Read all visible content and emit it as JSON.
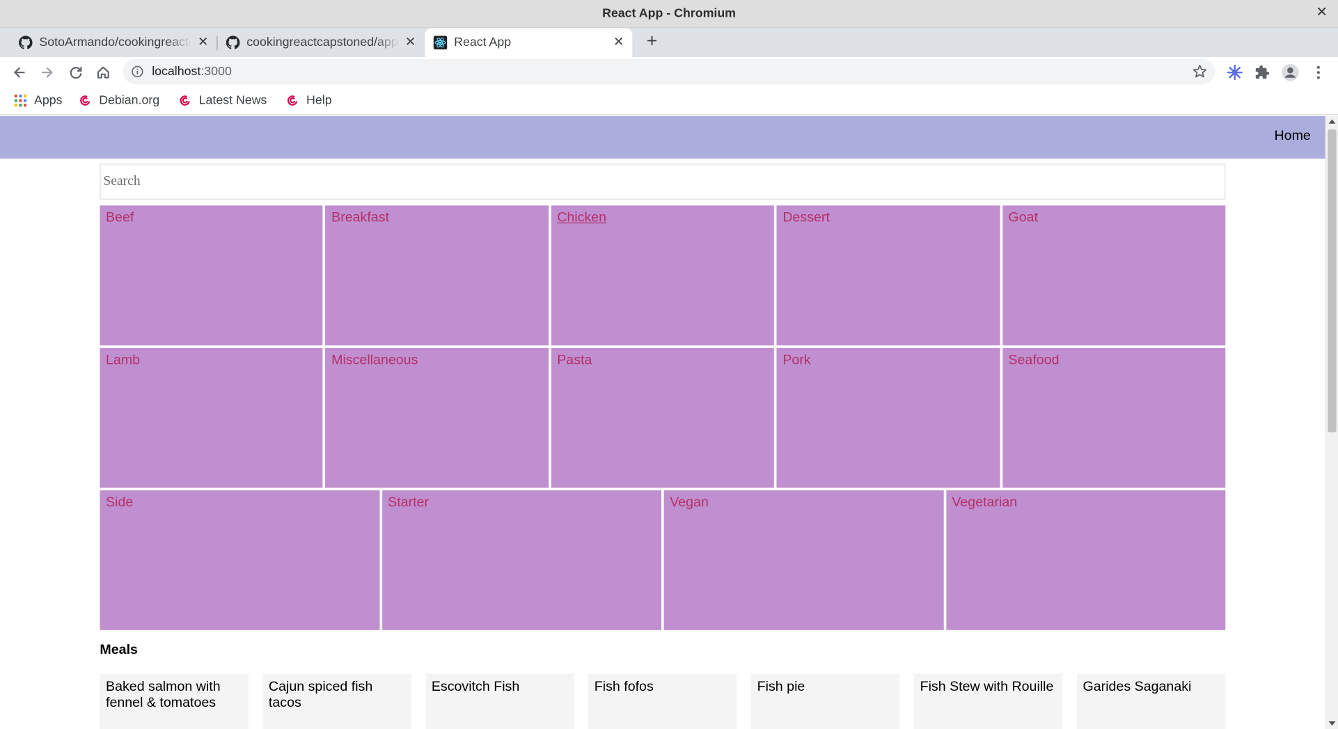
{
  "window": {
    "title": "React App - Chromium",
    "close_glyph": "✕"
  },
  "tabs": [
    {
      "label": "SotoArmando/cookingreactcapstoned",
      "icon": "github-icon",
      "active": false
    },
    {
      "label": "cookingreactcapstoned/app",
      "icon": "github-icon",
      "active": false
    },
    {
      "label": "React App",
      "icon": "react-icon",
      "active": true
    }
  ],
  "tab_close_glyph": "✕",
  "new_tab_glyph": "+",
  "address_bar": {
    "host": "localhost",
    "port": ":3000"
  },
  "bookmarks": [
    {
      "label": "Apps",
      "icon": "apps-grid-icon"
    },
    {
      "label": "Debian.org",
      "icon": "debian-swirl-icon"
    },
    {
      "label": "Latest News",
      "icon": "debian-swirl-icon"
    },
    {
      "label": "Help",
      "icon": "debian-swirl-icon"
    }
  ],
  "app": {
    "nav": {
      "home_label": "Home"
    },
    "search": {
      "placeholder": "Search",
      "value": ""
    },
    "categories": [
      [
        "Beef",
        "Breakfast",
        "Chicken",
        "Dessert",
        "Goat"
      ],
      [
        "Lamb",
        "Miscellaneous",
        "Pasta",
        "Pork",
        "Seafood"
      ],
      [
        "Side",
        "Starter",
        "Vegan",
        "Vegetarian"
      ]
    ],
    "hovered_category": "Chicken",
    "meals_heading": "Meals",
    "meals": [
      "Baked salmon with fennel & tomatoes",
      "Cajun spiced fish tacos",
      "Escovitch Fish",
      "Fish fofos",
      "Fish pie",
      "Fish Stew with Rouille",
      "Garides Saganaki"
    ]
  },
  "colors": {
    "app_nav": "#abaddd",
    "category_tile": "#c08fcf",
    "category_link": "#b5306b",
    "meal_card": "#f4f4f4"
  }
}
